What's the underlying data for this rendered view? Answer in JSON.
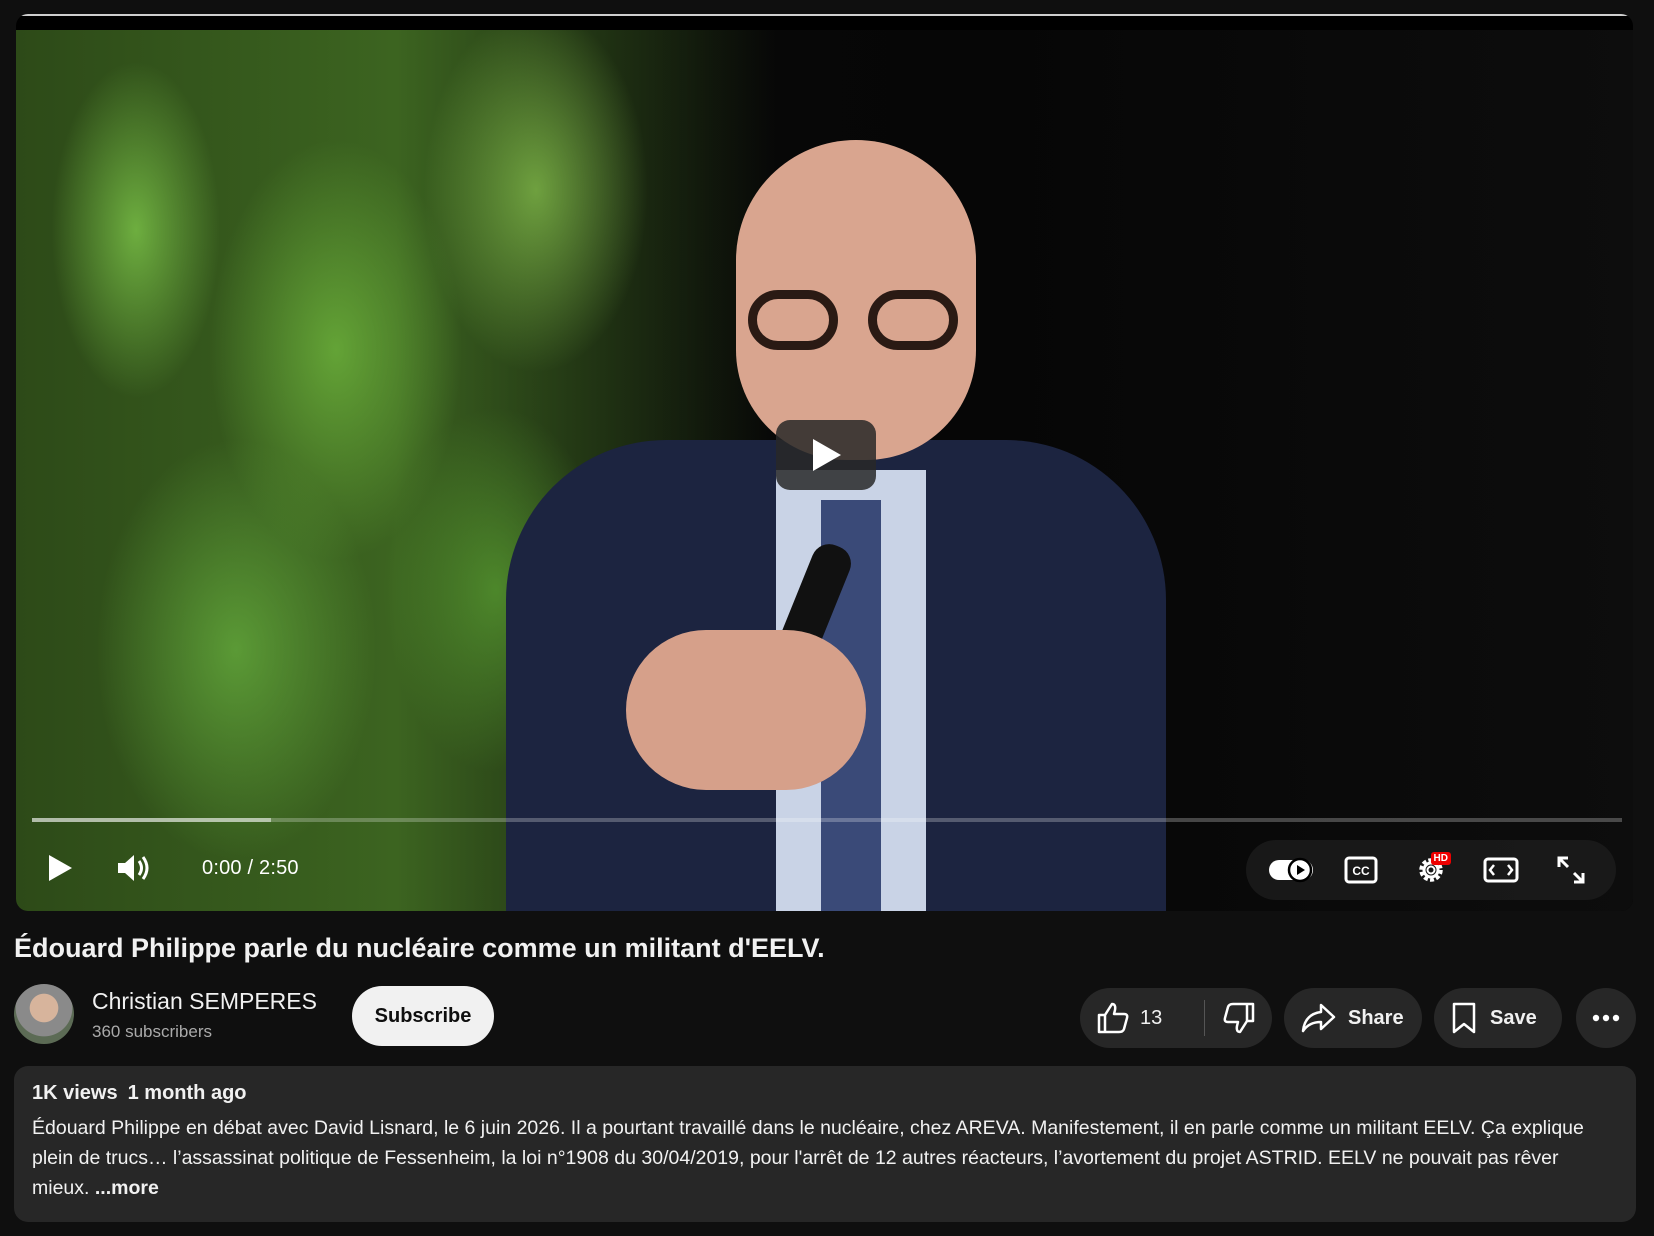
{
  "player": {
    "current_time": "0:00",
    "separator": " / ",
    "duration": "2:50",
    "buffered_fraction": 0.15,
    "played_fraction": 0.0,
    "hd_badge": "HD",
    "icons": [
      "play-icon",
      "volume-icon",
      "autoplay-toggle-icon",
      "cc-icon",
      "settings-icon",
      "theater-mode-icon",
      "fullscreen-icon"
    ]
  },
  "video": {
    "title": "Édouard Philippe parle du nucléaire comme un militant d'EELV."
  },
  "channel": {
    "name": "Christian SEMPERES",
    "subscribers": "360 subscribers",
    "subscribe_label": "Subscribe"
  },
  "actions": {
    "like_count": "13",
    "share_label": "Share",
    "save_label": "Save"
  },
  "description": {
    "views": "1K views",
    "age": "1 month ago",
    "text": "Édouard Philippe en débat avec David Lisnard, le 6 juin 2026. Il a pourtant travaillé dans le nucléaire, chez AREVA. Manifestement, il en parle comme un militant EELV. Ça explique plein de trucs… l’assassinat politique de Fessenheim, la loi n°1908 du 30/04/2019, pour l'arrêt de 12 autres réacteurs, l’avortement du projet ASTRID. EELV ne pouvait pas rêver mieux. ",
    "more_label": "...more"
  },
  "colors": {
    "background": "#0f0f0f",
    "pill": "#272727",
    "hd_badge": "#e00000",
    "subscribe_bg": "#f1f1f1"
  }
}
